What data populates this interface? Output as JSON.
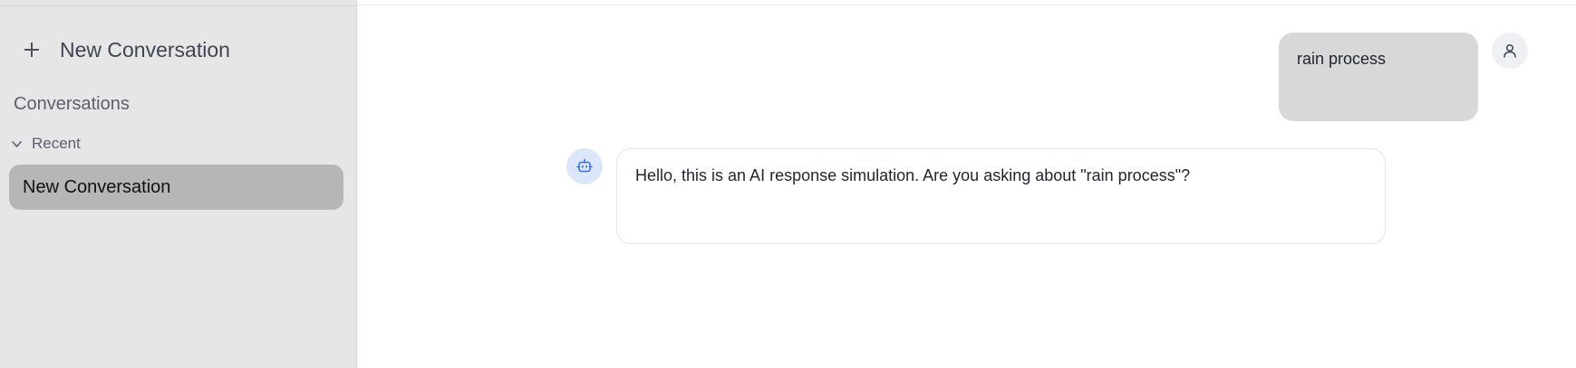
{
  "sidebar": {
    "new_conversation_label": "New Conversation",
    "conversations_heading": "Conversations",
    "recent_label": "Recent",
    "items": [
      {
        "label": "New Conversation",
        "selected": true
      }
    ]
  },
  "chat": {
    "messages": [
      {
        "role": "user",
        "text": "rain process"
      },
      {
        "role": "assistant",
        "text": "Hello, this is an AI response simulation. Are you asking about \"rain process\"?"
      }
    ]
  },
  "icons": {
    "new_conversation": "plus-icon",
    "recent_toggle": "chevron-down-icon",
    "user_avatar": "user-icon",
    "assistant_avatar": "robot-icon"
  },
  "colors": {
    "sidebar_bg": "#e6e6e6",
    "selected_item_bg": "#b6b6b6",
    "user_bubble_bg": "#d8d8d8",
    "assistant_avatar_bg": "#dbe6fb",
    "assistant_icon": "#3b6fd8"
  }
}
